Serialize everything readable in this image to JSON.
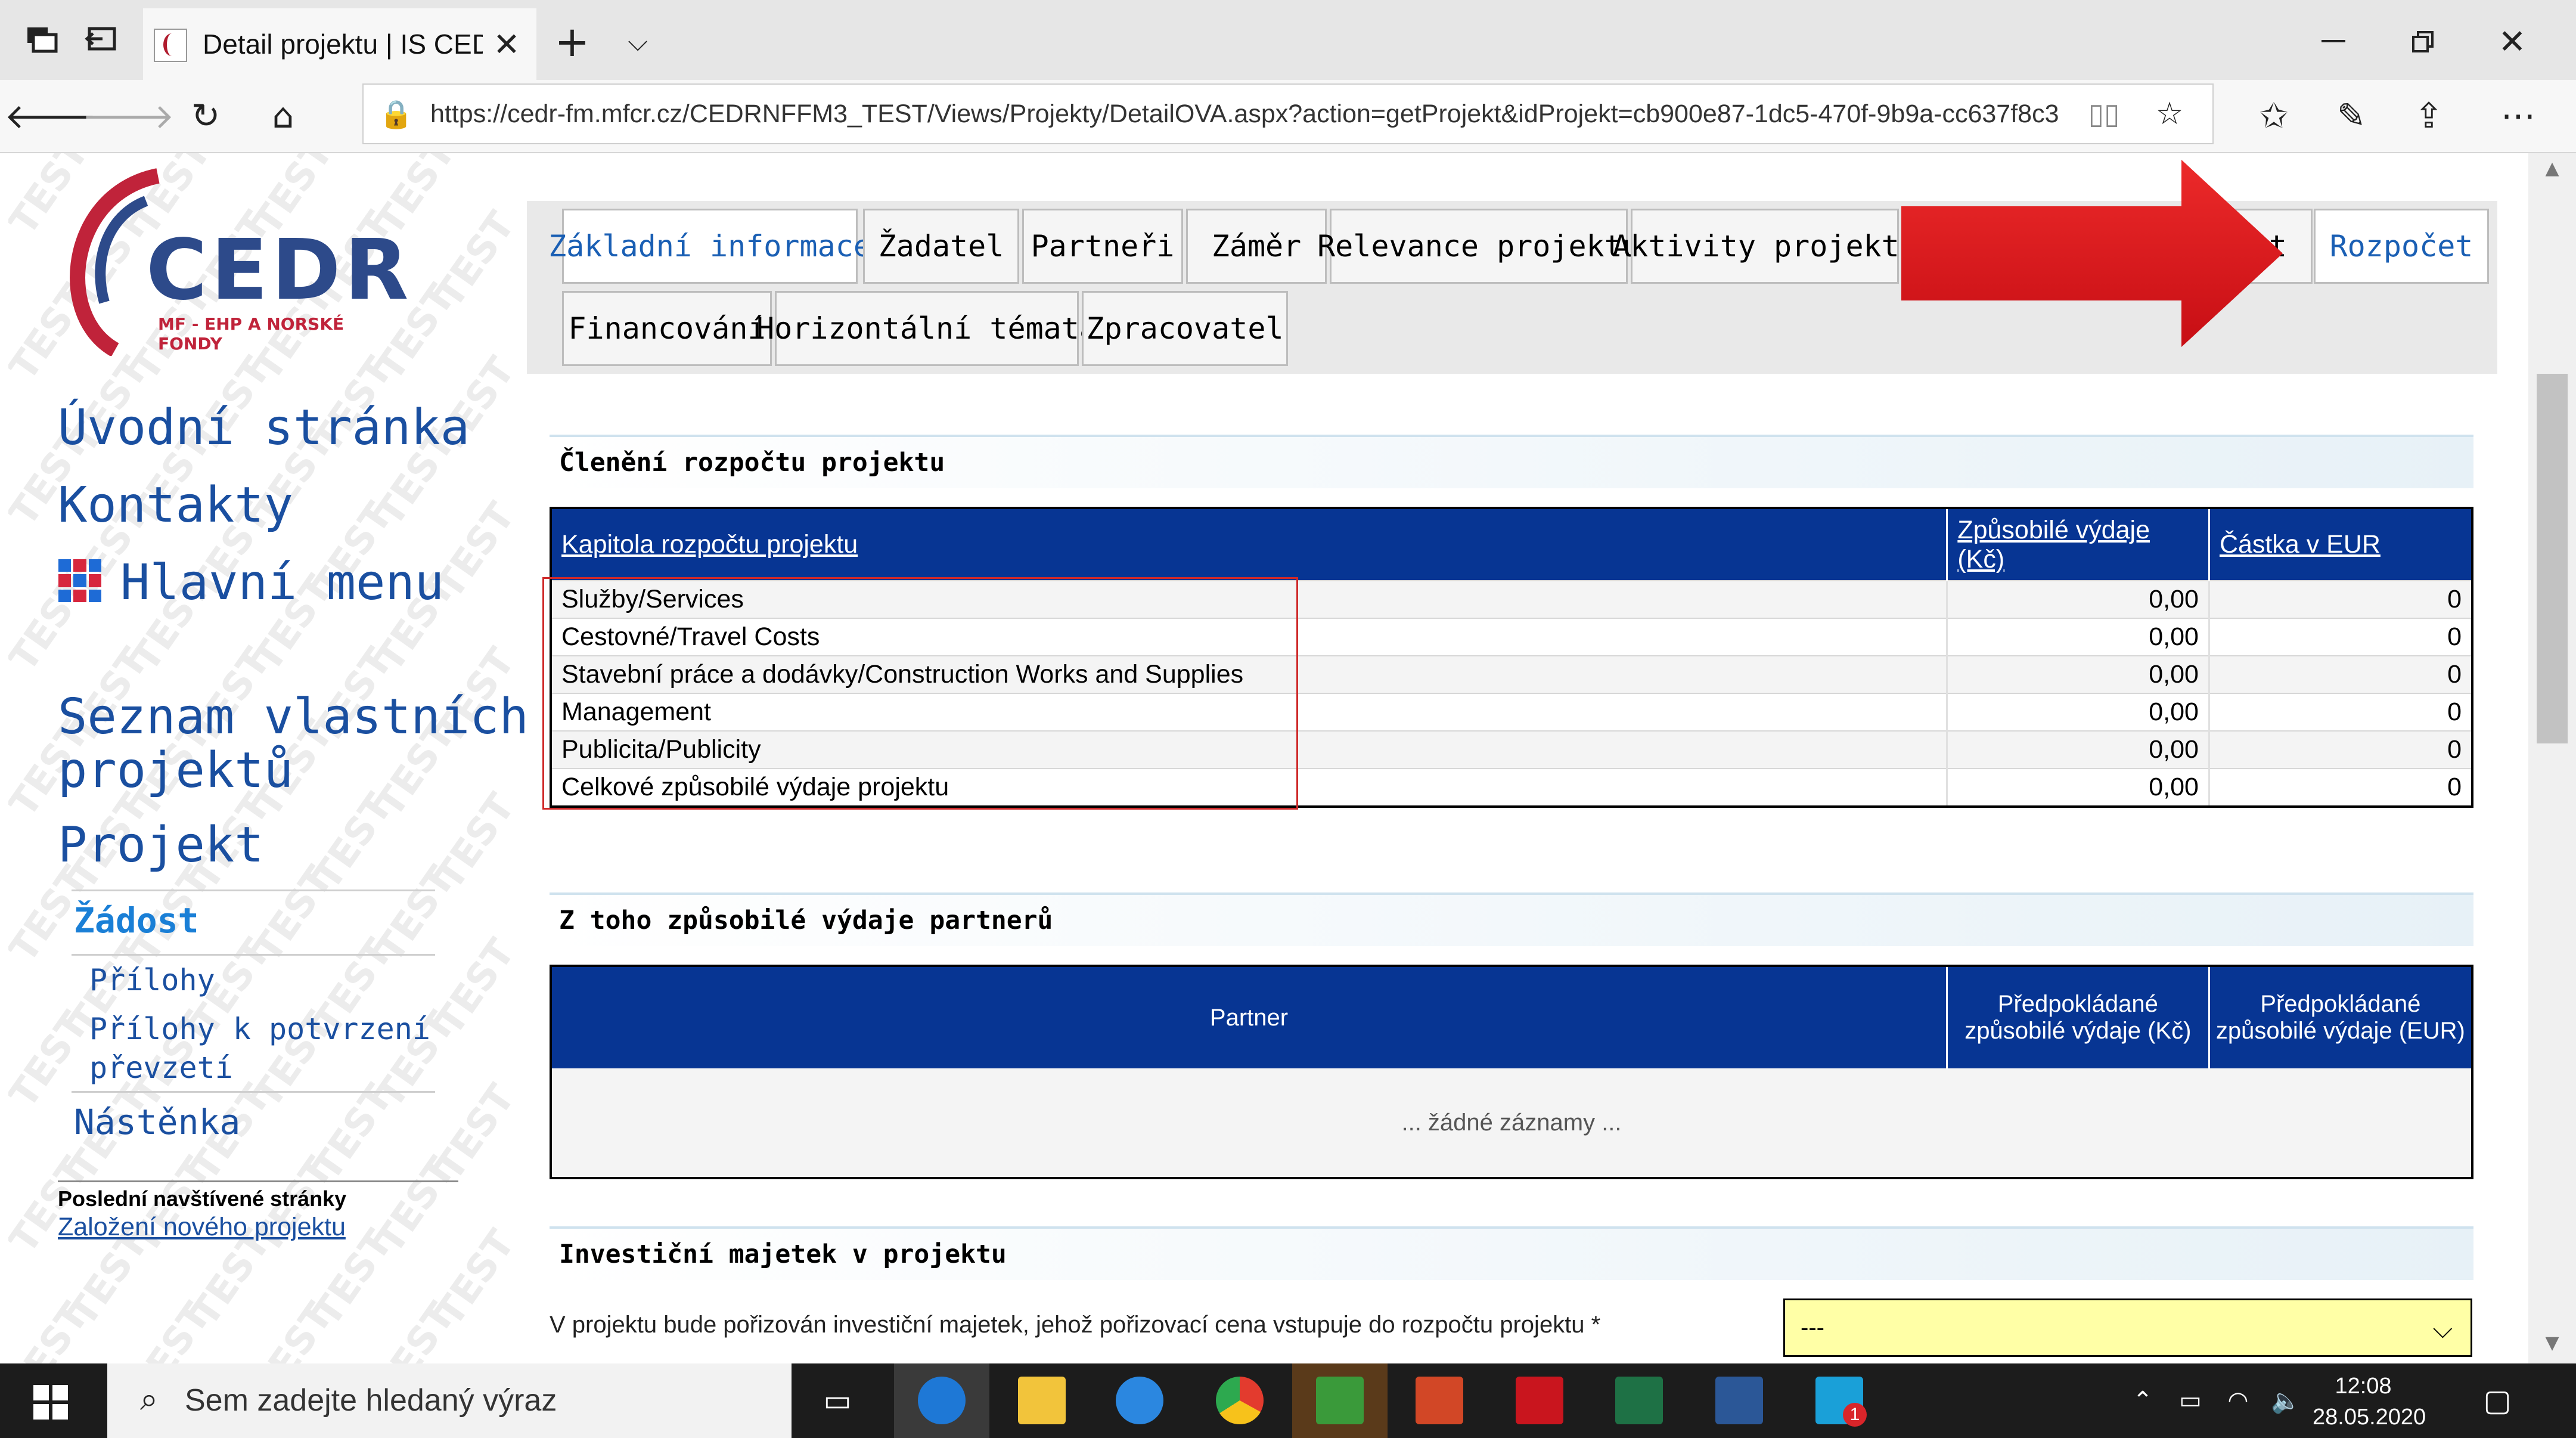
{
  "browser": {
    "tab_title": "Detail projektu | IS CEDR",
    "url": "https://cedr-fm.mfcr.cz/CEDRNFFM3_TEST/Views/Projekty/DetailOVA.aspx?action=getProjekt&idProjekt=cb900e87-1dc5-470f-9b9a-cc637f8c3"
  },
  "logo": {
    "name": "CEDR",
    "subtitle": "MF - EHP A NORSKÉ FONDY",
    "watermark": "TEST"
  },
  "nav": {
    "home": "Úvodní stránka",
    "contacts": "Kontakty",
    "main_menu": "Hlavní menu",
    "own_projects_line1": "Seznam vlastních",
    "own_projects_line2": "projektů",
    "project": "Projekt",
    "application": "Žádost",
    "attachments": "Přílohy",
    "attachments_confirm_line1": "Přílohy k potvrzení",
    "attachments_confirm_line2": "převzetí",
    "board": "Nástěnka",
    "recent_heading": "Poslední navštívené stránky",
    "recent_link": "Založení nového projektu"
  },
  "tabs": {
    "row1": [
      "Základní informace",
      "Žadatel",
      "Partneři",
      "Záměr",
      "Relevance projektu",
      "Aktivity projektu",
      "",
      "Rozpočet"
    ],
    "hidden_tab_fragment": "t",
    "row2": [
      "Financování",
      "Horizontální témata",
      "Zpracovatel"
    ],
    "active": "Rozpočet"
  },
  "budget": {
    "section_title": "Členění rozpočtu projektu",
    "columns": [
      "Kapitola rozpočtu projektu",
      "Způsobilé výdaje (Kč)",
      "Částka v EUR"
    ],
    "rows": [
      {
        "chapter": "Služby/Services",
        "czk": "0,00",
        "eur": "0"
      },
      {
        "chapter": "Cestovné/Travel Costs",
        "czk": "0,00",
        "eur": "0"
      },
      {
        "chapter": "Stavební práce a dodávky/Construction Works and Supplies",
        "czk": "0,00",
        "eur": "0"
      },
      {
        "chapter": "Management",
        "czk": "0,00",
        "eur": "0"
      },
      {
        "chapter": "Publicita/Publicity",
        "czk": "0,00",
        "eur": "0"
      },
      {
        "chapter": "Celkové způsobilé výdaje projektu",
        "czk": "0,00",
        "eur": "0"
      }
    ]
  },
  "partners": {
    "section_title": "Z toho způsobilé výdaje partnerů",
    "columns": [
      "Partner",
      "Předpokládané způsobilé výdaje (Kč)",
      "Předpokládané způsobilé výdaje (EUR)"
    ],
    "empty": "... žádné záznamy ..."
  },
  "investment": {
    "section_title": "Investiční majetek v projektu",
    "label": "V projektu bude pořizován investiční majetek, jehož pořizovací cena vstupuje do rozpočtu projektu *",
    "value": "---"
  },
  "taskbar": {
    "search_placeholder": "Sem zadejte hledaný výraz",
    "time": "12:08",
    "date": "28.05.2020",
    "notification_badge": "1"
  },
  "colors": {
    "header_blue": "#073593",
    "link_blue": "#1a4fa0",
    "highlight_red": "#d9181f",
    "select_yellow": "#ffffa6"
  }
}
